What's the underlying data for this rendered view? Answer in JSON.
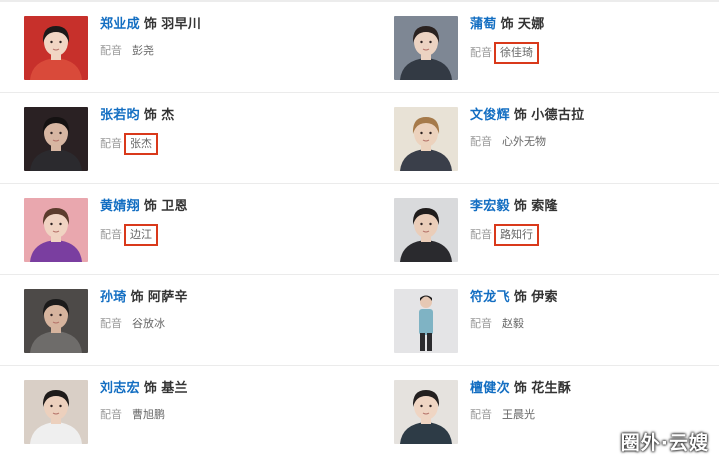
{
  "cast": [
    {
      "actor": "郑业成",
      "role_word": "饰",
      "role": "羽早川",
      "voice_label": "配音",
      "voice": "彭尧",
      "highlight": false,
      "avatar_icon": "actor-portrait",
      "bg": "#c7302b",
      "skin": "#f1d6c4",
      "hair": "#1c1a1a",
      "cloth": "#d94a3a"
    },
    {
      "actor": "蒲萄",
      "role_word": "饰",
      "role": "天娜",
      "voice_label": "配音",
      "voice": "徐佳琦",
      "highlight": true,
      "avatar_icon": "actress-portrait",
      "bg": "#7e8794",
      "skin": "#ecd3c2",
      "hair": "#2a2220",
      "cloth": "#333a44"
    },
    {
      "actor": "张若昀",
      "role_word": "饰",
      "role": "杰",
      "voice_label": "配音",
      "voice": "张杰",
      "highlight": true,
      "avatar_icon": "actor-portrait",
      "bg": "#2a2123",
      "skin": "#d7b6a2",
      "hair": "#151212",
      "cloth": "#2b2a2e"
    },
    {
      "actor": "文俊辉",
      "role_word": "饰",
      "role": "小德古拉",
      "voice_label": "配音",
      "voice": "心外无物",
      "highlight": false,
      "avatar_icon": "actor-portrait",
      "bg": "#e8e2d6",
      "skin": "#ecd2bd",
      "hair": "#a67a4a",
      "cloth": "#3a3f4a"
    },
    {
      "actor": "黄婧翔",
      "role_word": "饰",
      "role": "卫恩",
      "voice_label": "配音",
      "voice": "边江",
      "highlight": true,
      "avatar_icon": "actor-portrait",
      "bg": "#e9a7ae",
      "skin": "#f0d3c2",
      "hair": "#5b3b2c",
      "cloth": "#7a3ea0"
    },
    {
      "actor": "李宏毅",
      "role_word": "饰",
      "role": "索隆",
      "voice_label": "配音",
      "voice": "路知行",
      "highlight": true,
      "avatar_icon": "actor-portrait",
      "bg": "#d9dadc",
      "skin": "#eacdb9",
      "hair": "#1f1c1c",
      "cloth": "#2a2a2e"
    },
    {
      "actor": "孙琦",
      "role_word": "饰",
      "role": "阿萨辛",
      "voice_label": "配音",
      "voice": "谷放冰",
      "highlight": false,
      "avatar_icon": "actor-portrait",
      "bg": "#4d4a48",
      "skin": "#d6b49e",
      "hair": "#1b1a1a",
      "cloth": "#6e6c6a"
    },
    {
      "actor": "符龙飞",
      "role_word": "饰",
      "role": "伊索",
      "voice_label": "配音",
      "voice": "赵毅",
      "highlight": false,
      "avatar_icon": "actor-fullbody",
      "bg": "#e4e4e6",
      "skin": "#e6c8b4",
      "hair": "#1d1b1b",
      "cloth": "#7fb3c4"
    },
    {
      "actor": "刘志宏",
      "role_word": "饰",
      "role": "基兰",
      "voice_label": "配音",
      "voice": "曹旭鹏",
      "highlight": false,
      "avatar_icon": "actor-portrait",
      "bg": "#d9cfc6",
      "skin": "#ecd0bd",
      "hair": "#1e1b1a",
      "cloth": "#efefef"
    },
    {
      "actor": "檀健次",
      "role_word": "饰",
      "role": "花生酥",
      "voice_label": "配音",
      "voice": "王晨光",
      "highlight": false,
      "avatar_icon": "actor-portrait",
      "bg": "#e5e2de",
      "skin": "#efd5c3",
      "hair": "#232020",
      "cloth": "#2d3b46"
    }
  ],
  "watermark": "圈外·云嫂"
}
